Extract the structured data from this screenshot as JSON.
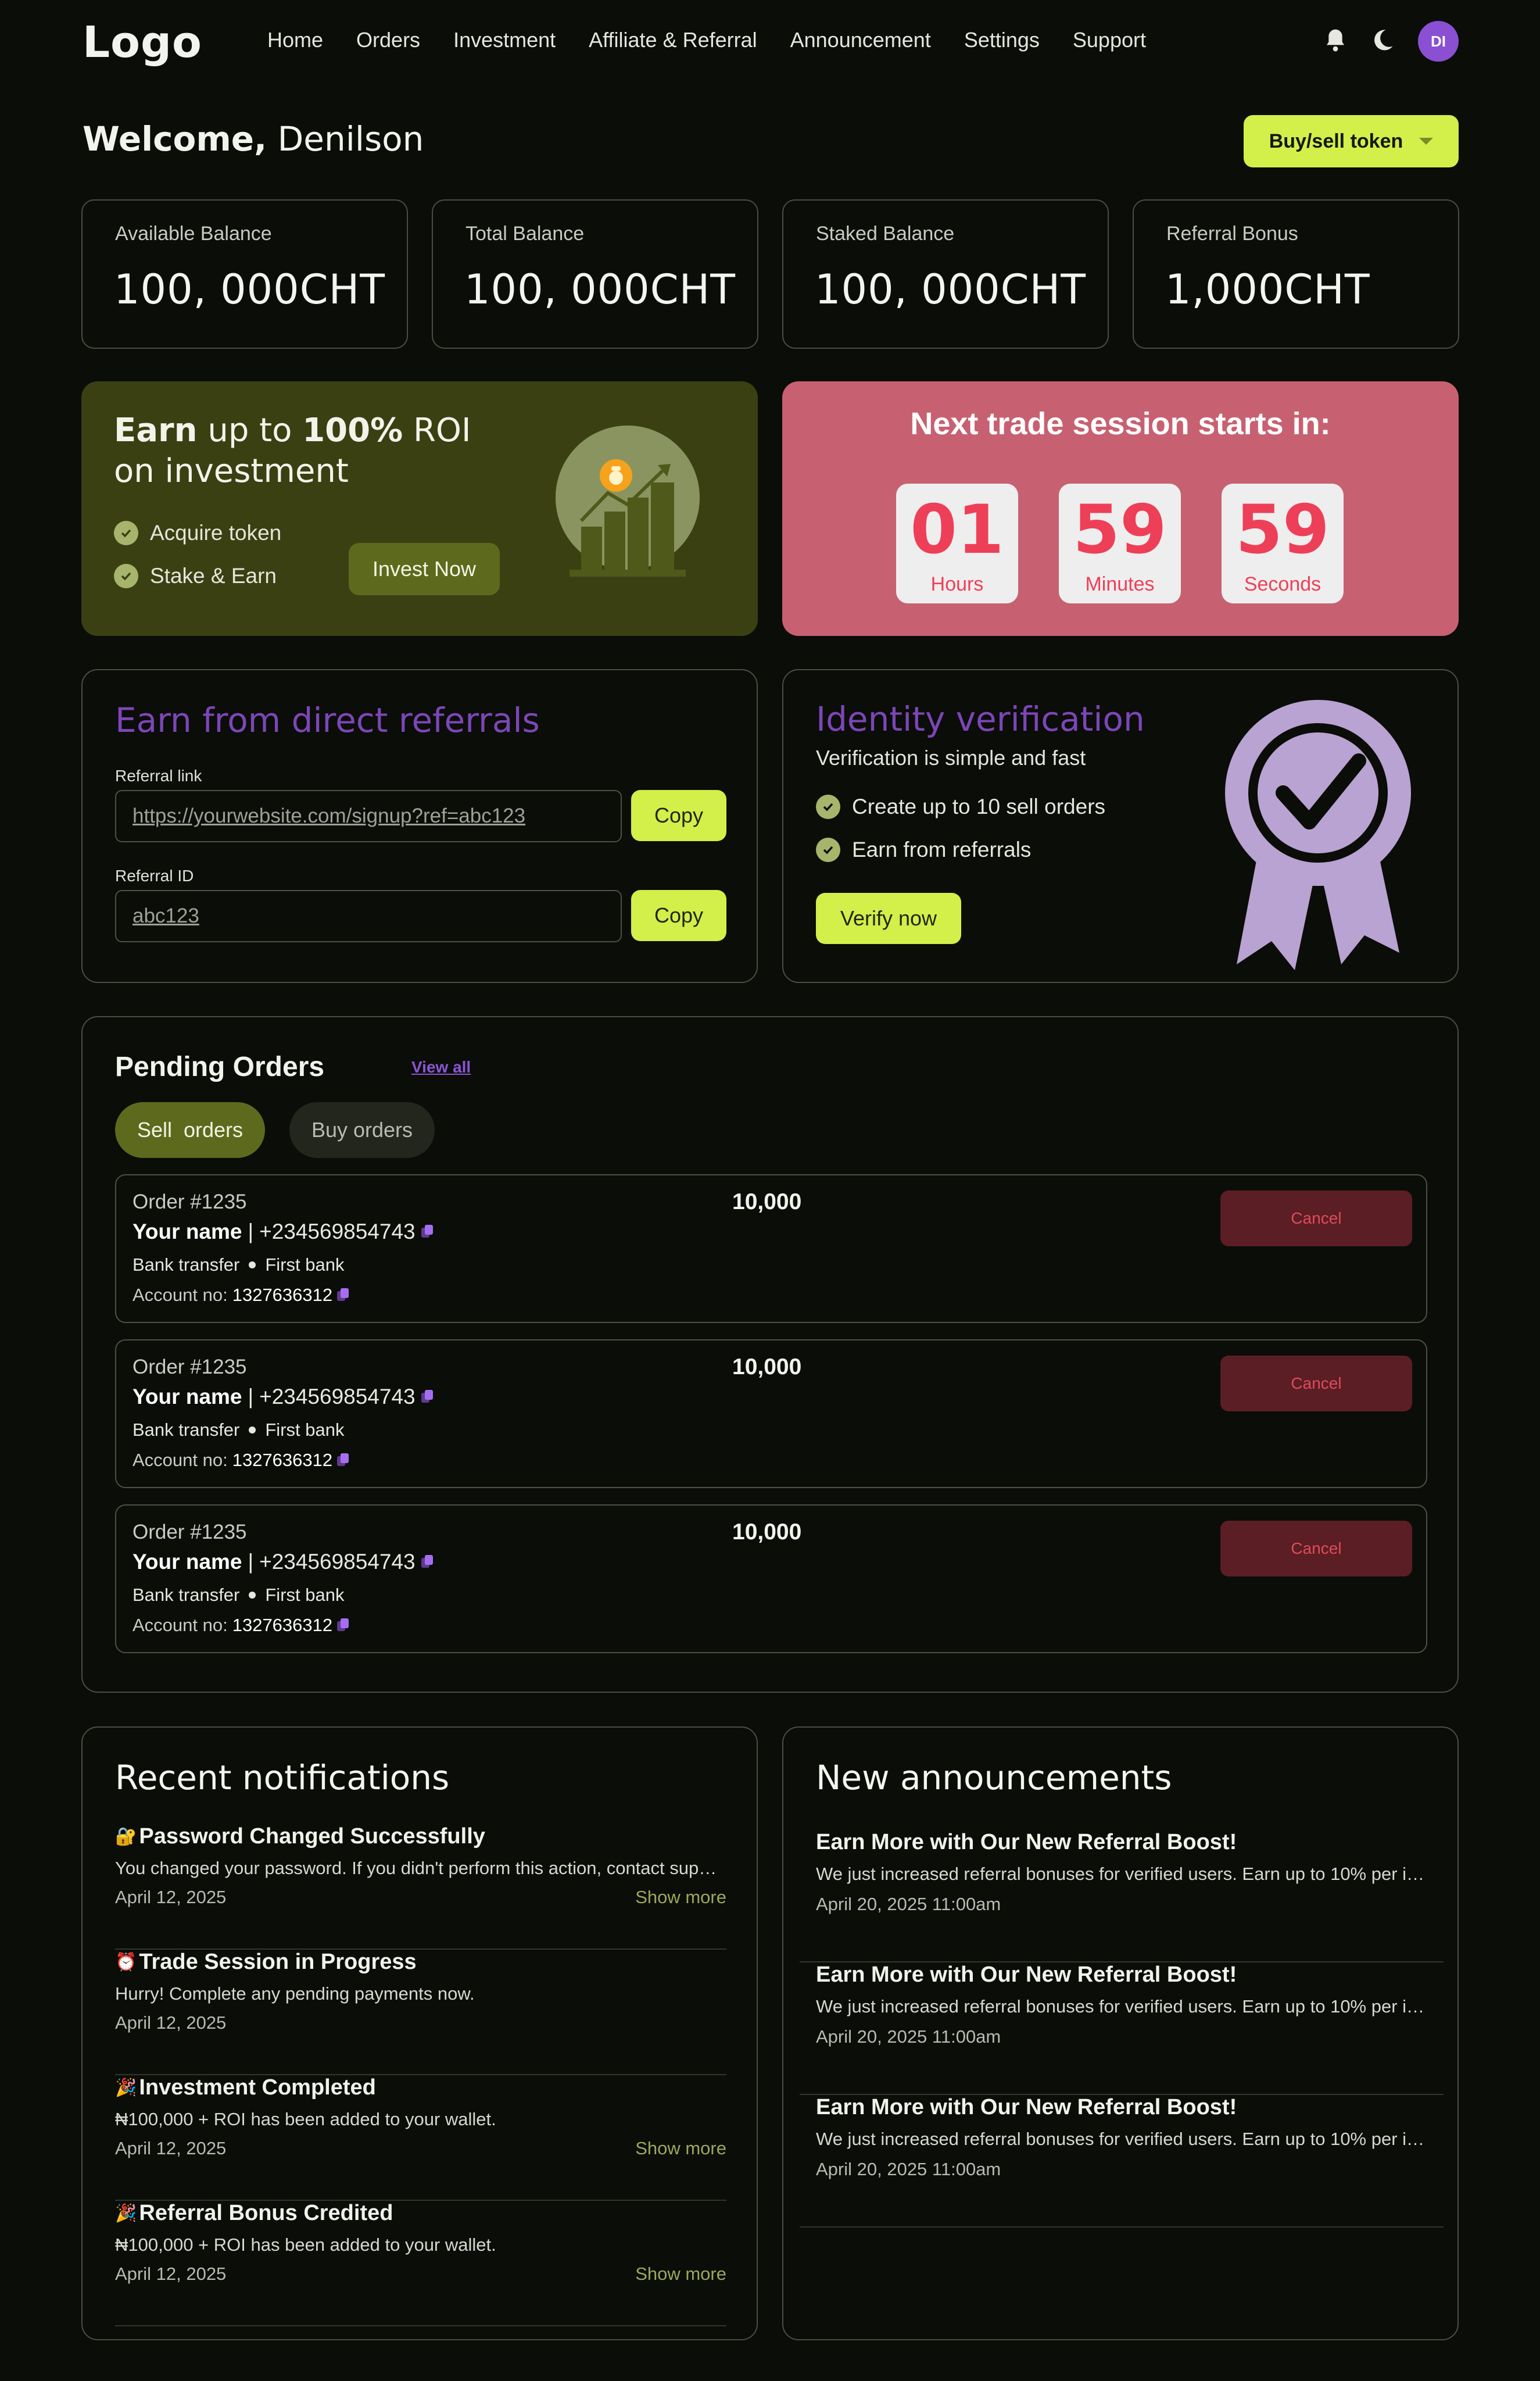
{
  "nav": {
    "logo": "Logo",
    "links": [
      "Home",
      "Orders",
      "Investment",
      "Affiliate & Referral",
      "Announcement",
      "Settings",
      "Support"
    ],
    "avatar_initials": "DI",
    "icons": [
      "bell-icon",
      "moon-icon"
    ]
  },
  "welcome": {
    "greeting": "Welcome,",
    "name": "Denilson"
  },
  "buy_sell": {
    "label": "Buy/sell token"
  },
  "balances": [
    {
      "label": "Available Balance",
      "value": "100, 000CHT"
    },
    {
      "label": "Total Balance",
      "value": "100, 000CHT"
    },
    {
      "label": "Staked Balance",
      "value": "100, 000CHT"
    },
    {
      "label": "Referral Bonus",
      "value": "1,000CHT"
    }
  ],
  "earn_banner": {
    "title_bold_1": "Earn",
    "title_1": " up to ",
    "title_bold_2": "100%",
    "title_2": " ROI on investment",
    "points": [
      "Acquire token",
      "Stake & Earn"
    ],
    "button": "Invest Now"
  },
  "timer": {
    "title": "Next trade session starts in:",
    "units": [
      {
        "value": "01",
        "label": "Hours"
      },
      {
        "value": "59",
        "label": "Minutes"
      },
      {
        "value": "59",
        "label": "Seconds"
      }
    ]
  },
  "referral": {
    "title": "Earn from direct referrals",
    "link_label": "Referral link",
    "link_value": " https://yourwebsite.com/signup?ref=abc123",
    "id_label": "Referral ID",
    "id_value": "abc123",
    "copy_label": "Copy"
  },
  "identity": {
    "title": "Identity verification",
    "subtitle": "Verification is simple and fast",
    "points": [
      "Create up to 10 sell orders",
      "Earn from referrals"
    ],
    "button": "Verify now"
  },
  "pending": {
    "title": "Pending Orders",
    "view_all": "View all",
    "tabs": [
      "Sell  orders",
      "Buy orders"
    ],
    "orders": [
      {
        "id": "Order #1235",
        "name": "Your name",
        "phone": "+234569854743",
        "method": "Bank transfer",
        "bank": "First bank",
        "account_label": "Account no:",
        "account": "1327636312",
        "amount": "10,000",
        "action": "Cancel"
      },
      {
        "id": "Order #1235",
        "name": "Your name",
        "phone": "+234569854743",
        "method": "Bank transfer",
        "bank": "First bank",
        "account_label": "Account no:",
        "account": "1327636312",
        "amount": "10,000",
        "action": "Cancel"
      },
      {
        "id": "Order #1235",
        "name": "Your name",
        "phone": "+234569854743",
        "method": "Bank transfer",
        "bank": "First bank",
        "account_label": "Account no:",
        "account": "1327636312",
        "amount": "10,000",
        "action": "Cancel"
      }
    ]
  },
  "notifications": {
    "title": "Recent notifications",
    "items": [
      {
        "emoji": "🔐",
        "title": "Password Changed Successfully",
        "body": "You changed your password. If you didn't perform this action, contact support immediately.",
        "date": "April 12, 2025",
        "more": "Show more"
      },
      {
        "emoji": "⏰",
        "title": "Trade Session in Progress",
        "body": "Hurry! Complete any pending payments now.",
        "date": "April 12, 2025",
        "more": ""
      },
      {
        "emoji": "🎉",
        "title": "Investment Completed",
        "body": "₦100,000 + ROI has been added to your wallet.",
        "date": "April 12, 2025",
        "more": "Show more"
      },
      {
        "emoji": "🎉",
        "title": "Referral Bonus Credited",
        "body": "₦100,000 + ROI has been added to your wallet.",
        "date": "April 12, 2025",
        "more": "Show more"
      }
    ]
  },
  "announcements": {
    "title": "New announcements",
    "items": [
      {
        "title": "Earn More with Our New Referral Boost!",
        "body": "We just increased referral bonuses for verified users. Earn up to 10% per invite today.",
        "date": "April 20, 2025 11:00am"
      },
      {
        "title": "Earn More with Our New Referral Boost!",
        "body": "We just increased referral bonuses for verified users. Earn up to 10% per invite today.",
        "date": "April 20, 2025 11:00am"
      },
      {
        "title": "Earn More with Our New Referral Boost!",
        "body": "We just increased referral bonuses for verified users. Earn up to 10% per invite today.",
        "date": "April 20, 2025 11:00am"
      }
    ]
  }
}
